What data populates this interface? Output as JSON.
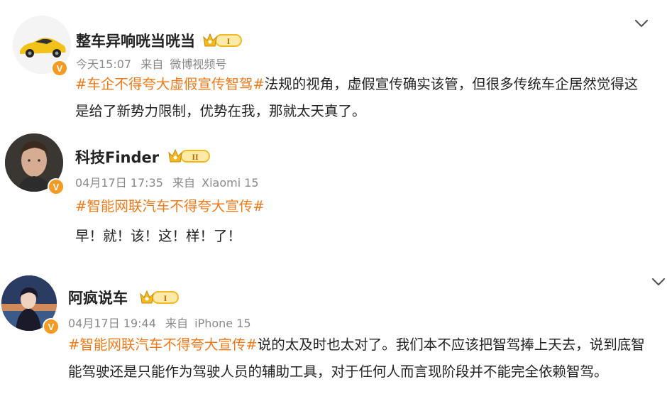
{
  "posts": [
    {
      "username": "整车异响咣当咣当",
      "level": "I",
      "time": "今天15:07",
      "source_prefix": "来自",
      "source": "微博视频号",
      "hashtag": "#车企不得夸大虚假宣传智驾#",
      "text": "法规的视角，虚假宣传确实该管，但很多传统车企居然觉得这是给了新势力限制，优势在我，那就太天真了。",
      "verified_badge": "V"
    },
    {
      "username": "科技Finder",
      "level": "II",
      "time": "04月17日 17:35",
      "source_prefix": "来自",
      "source": "Xiaomi 15",
      "hashtag": "#智能网联汽车不得夸大宣传#",
      "text": "早！就！该！这！样！了！",
      "verified_badge": "V"
    },
    {
      "username": "阿疯说车",
      "level": "I",
      "time": "04月17日 19:44",
      "source_prefix": "来自",
      "source": "iPhone 15",
      "hashtag": "#智能网联汽车不得夸大宣传#",
      "text": "说的太及时也太对了。我们本不应该把智驾捧上天去，说到底智能驾驶还是只能作为驾驶人员的辅助工具，对于任何人而言现阶段并不能完全依赖智驾。",
      "verified_badge": "V"
    }
  ],
  "colors": {
    "hashtag": "#f07a1a",
    "verified": "#f59a23",
    "level_badge": "#f5b81f",
    "meta": "#8a8a8a"
  },
  "icons": {
    "chevron": "chevron-down-icon",
    "crown": "crown-icon"
  }
}
